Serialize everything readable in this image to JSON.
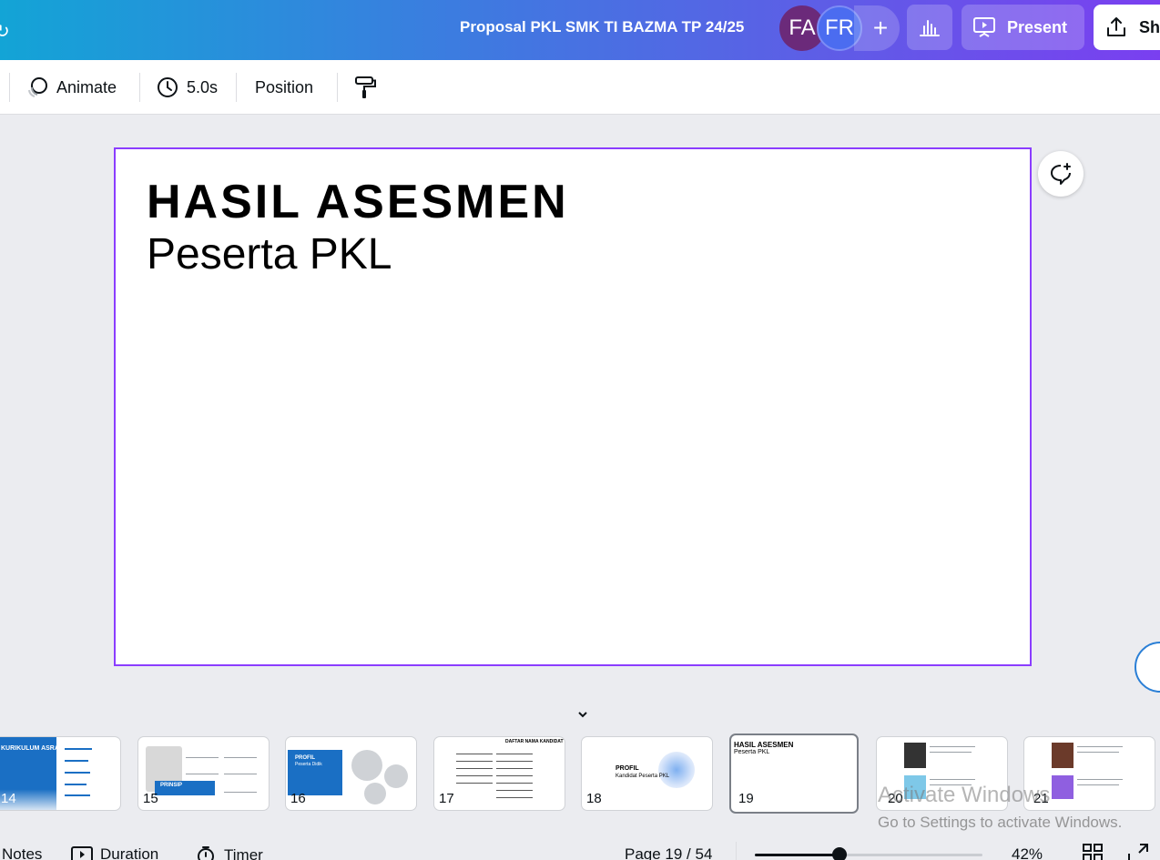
{
  "header": {
    "title": "Proposal PKL SMK TI BAZMA TP 24/25",
    "collaborators": [
      "FA",
      "FR"
    ],
    "add_label": "+",
    "present_label": "Present",
    "share_label": "Sh"
  },
  "toolbar": {
    "animate_label": "Animate",
    "duration_label": "5.0s",
    "position_label": "Position"
  },
  "slide": {
    "title": "HASIL ASESMEN",
    "subtitle": "Peserta PKL"
  },
  "thumbnails": [
    {
      "number": "14",
      "title": "KURIKULUM ASRAMA"
    },
    {
      "number": "15",
      "title": "PRINSIP"
    },
    {
      "number": "16",
      "title": "PROFIL",
      "subtitle": "Peserta Didik"
    },
    {
      "number": "17",
      "title": "DAFTAR NAMA KANDIDAT"
    },
    {
      "number": "18",
      "title": "PROFIL",
      "subtitle": "Kandidat Peserta PKL"
    },
    {
      "number": "19",
      "title": "HASIL ASESMEN",
      "subtitle": "Peserta PKL"
    },
    {
      "number": "20"
    },
    {
      "number": "21"
    }
  ],
  "watermark": {
    "line1": "Activate Windows",
    "line2": "Go to Settings to activate Windows."
  },
  "footer": {
    "notes_label": "Notes",
    "duration_label": "Duration",
    "timer_label": "Timer",
    "page_indicator": "Page 19 / 54",
    "zoom_label": "42%",
    "zoom_fraction": 0.37
  },
  "colors": {
    "accent": "#8b3dff",
    "brand_blue": "#1a6fc4"
  }
}
